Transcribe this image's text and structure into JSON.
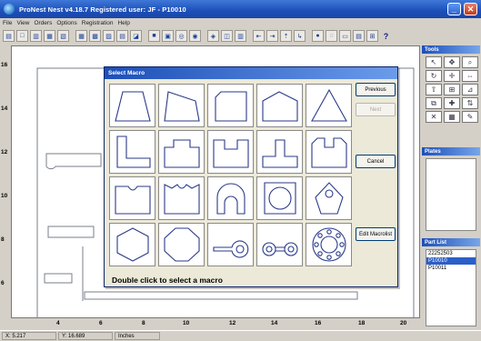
{
  "app": {
    "title": "ProNest Nest v4.18.7 Registered user: JF - P10010",
    "menu": [
      "File",
      "View",
      "Orders",
      "Options",
      "Registration",
      "Help"
    ]
  },
  "rulers": {
    "vertical": [
      "16",
      "14",
      "12",
      "10",
      "8",
      "6"
    ],
    "horizontal": [
      "4",
      "6",
      "8",
      "10",
      "12",
      "14",
      "16",
      "18",
      "20"
    ]
  },
  "status": {
    "x": "X: 5.217",
    "y": "Y: 16.689",
    "units": "Inches"
  },
  "panels": {
    "tools_title": "Tools",
    "plates_title": "Plates",
    "partlist_title": "Part List",
    "parts": [
      "22252503",
      "P10010",
      "P10011"
    ],
    "selected_part_index": 1
  },
  "dialog": {
    "title": "Select Macro",
    "previous_label": "Previous",
    "next_label": "Next",
    "cancel_label": "Cancel",
    "edit_label": "Edit Macrolist",
    "hint": "Double click to select a macro",
    "macros": [
      "trapezoid",
      "quadrilateral",
      "chamfered-rect",
      "pentagon",
      "triangle",
      "l-shape",
      "stepped-top",
      "u-notch",
      "t-shape",
      "double-notch",
      "notched-cup",
      "double-notched-cup",
      "arch-keyhole",
      "circle-ring",
      "tag-hole",
      "hexagon",
      "octagon",
      "lever-keyhole",
      "dumbbell",
      "flange-ring"
    ]
  }
}
